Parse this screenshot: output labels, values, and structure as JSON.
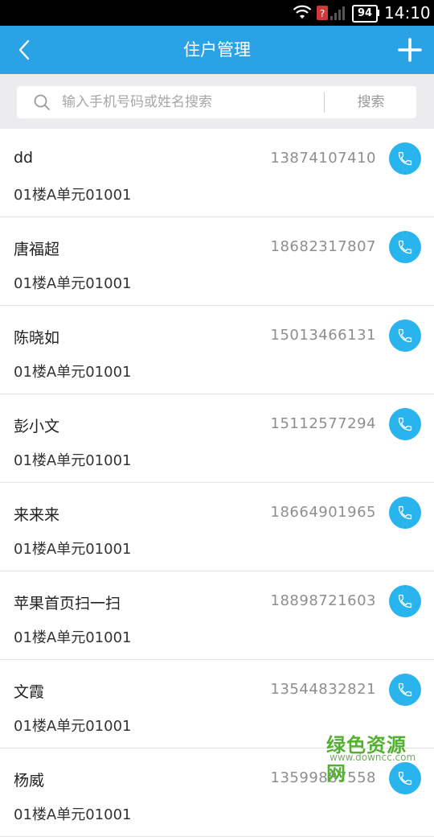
{
  "status_bar": {
    "battery": "94",
    "time": "14:10"
  },
  "header": {
    "title": "住户管理",
    "back_icon": "chevron-left-icon",
    "add_icon": "plus-icon"
  },
  "search": {
    "placeholder": "输入手机号码或姓名搜索",
    "button_label": "搜索"
  },
  "residents": [
    {
      "name": "dd",
      "phone": "13874107410",
      "address": "01楼A单元01001"
    },
    {
      "name": "唐福超",
      "phone": "18682317807",
      "address": "01楼A单元01001"
    },
    {
      "name": "陈晓如",
      "phone": "15013466131",
      "address": "01楼A单元01001"
    },
    {
      "name": "彭小文",
      "phone": "15112577294",
      "address": "01楼A单元01001"
    },
    {
      "name": "来来来",
      "phone": "18664901965",
      "address": "01楼A单元01001"
    },
    {
      "name": "苹果首页扫一扫",
      "phone": "18898721603",
      "address": "01楼A单元01001"
    },
    {
      "name": "文霞",
      "phone": "13544832821",
      "address": "01楼A单元01001"
    },
    {
      "name": "杨威",
      "phone": "13599887558",
      "address": "01楼A单元01001"
    }
  ],
  "watermark": {
    "cn": "绿色资源网",
    "url": "www.downcc.com"
  },
  "colors": {
    "header": "#2aa3e6",
    "call_button": "#2ab4ee"
  }
}
